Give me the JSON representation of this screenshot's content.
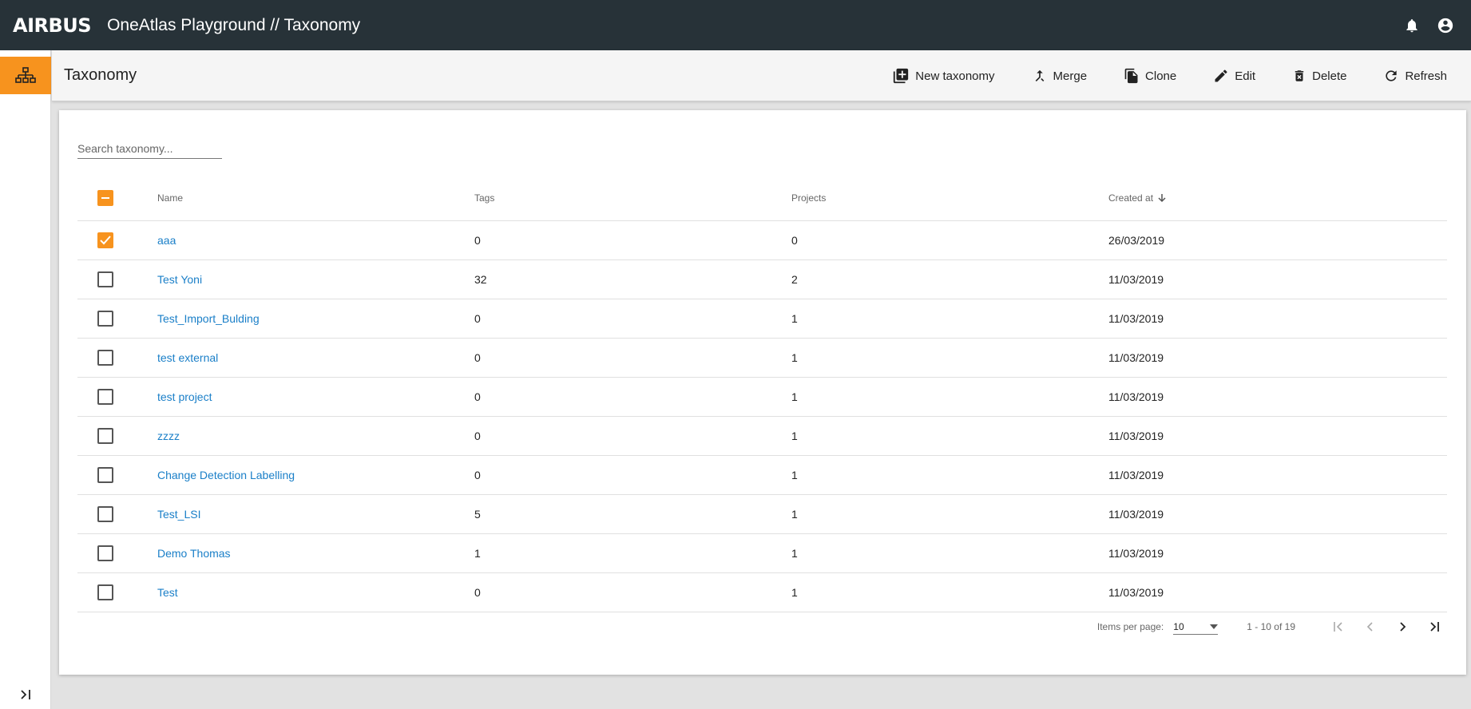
{
  "header": {
    "logo": "AIRBUS",
    "app_title": "OneAtlas Playground // Taxonomy",
    "icons": [
      "bell-icon",
      "account-circle-icon"
    ]
  },
  "sidebar": {
    "items": [
      {
        "icon": "hierarchy-icon",
        "active": true
      }
    ],
    "expand_icon": "expand-right-icon"
  },
  "toolbar": {
    "title": "Taxonomy",
    "actions": [
      {
        "label": "New taxonomy",
        "icon": "add-box-icon"
      },
      {
        "label": "Merge",
        "icon": "merge-icon"
      },
      {
        "label": "Clone",
        "icon": "copy-icon"
      },
      {
        "label": "Edit",
        "icon": "pencil-icon"
      },
      {
        "label": "Delete",
        "icon": "trash-icon"
      },
      {
        "label": "Refresh",
        "icon": "refresh-icon"
      }
    ]
  },
  "search": {
    "placeholder": "Search taxonomy..."
  },
  "table": {
    "columns": {
      "name": "Name",
      "tags": "Tags",
      "projects": "Projects",
      "created": "Created at"
    },
    "sort": {
      "column": "Created at",
      "direction": "desc"
    },
    "header_checkbox": "indeterminate",
    "rows": [
      {
        "name": "aaa",
        "tags": "0",
        "projects": "0",
        "created": "26/03/2019",
        "checked": true
      },
      {
        "name": "Test Yoni",
        "tags": "32",
        "projects": "2",
        "created": "11/03/2019",
        "checked": false
      },
      {
        "name": "Test_Import_Bulding",
        "tags": "0",
        "projects": "1",
        "created": "11/03/2019",
        "checked": false
      },
      {
        "name": "test external",
        "tags": "0",
        "projects": "1",
        "created": "11/03/2019",
        "checked": false
      },
      {
        "name": "test project",
        "tags": "0",
        "projects": "1",
        "created": "11/03/2019",
        "checked": false
      },
      {
        "name": "zzzz",
        "tags": "0",
        "projects": "1",
        "created": "11/03/2019",
        "checked": false
      },
      {
        "name": "Change Detection Labelling",
        "tags": "0",
        "projects": "1",
        "created": "11/03/2019",
        "checked": false
      },
      {
        "name": "Test_LSI",
        "tags": "5",
        "projects": "1",
        "created": "11/03/2019",
        "checked": false
      },
      {
        "name": "Demo Thomas",
        "tags": "1",
        "projects": "1",
        "created": "11/03/2019",
        "checked": false
      },
      {
        "name": "Test",
        "tags": "0",
        "projects": "1",
        "created": "11/03/2019",
        "checked": false
      }
    ]
  },
  "paginator": {
    "items_per_page_label": "Items per page:",
    "items_per_page": "10",
    "range": "1 - 10 of 19"
  },
  "colors": {
    "topbar": "#273238",
    "accent": "#f7931e",
    "link": "#1a7fc8"
  }
}
